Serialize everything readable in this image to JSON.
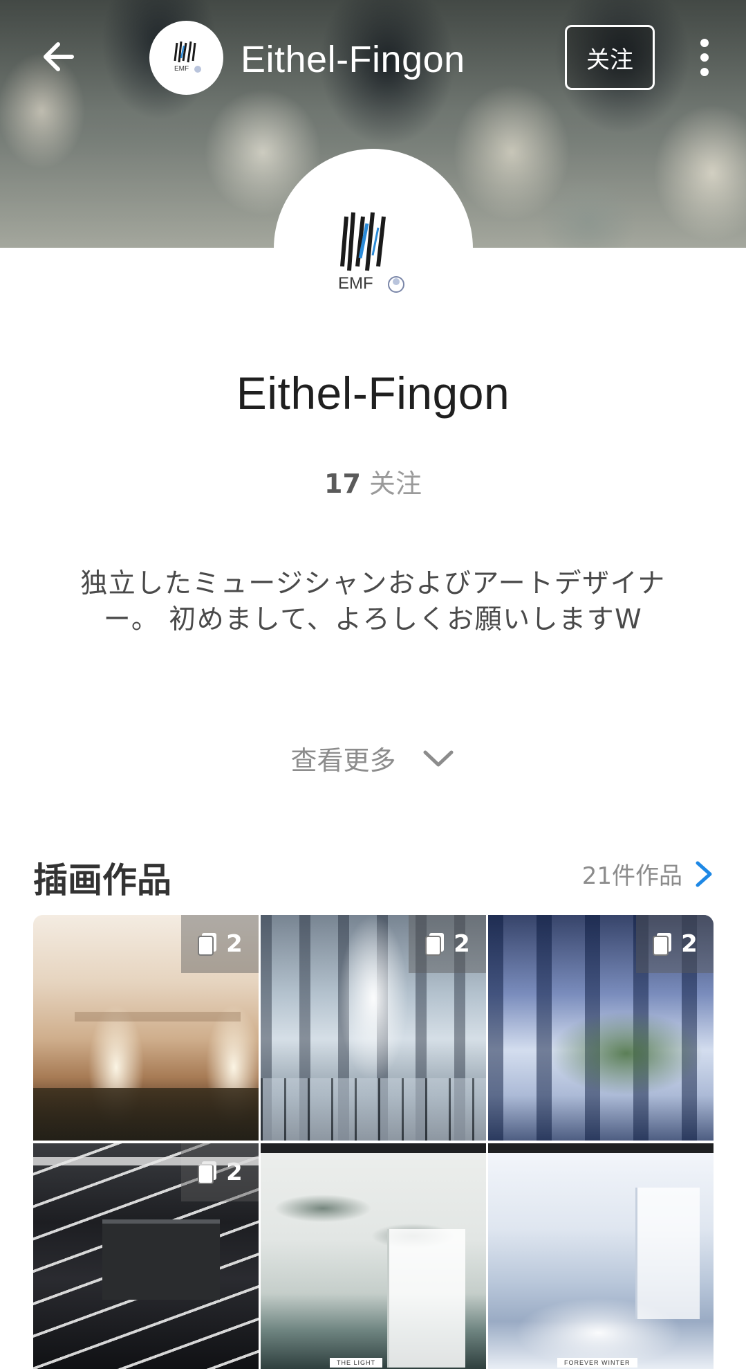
{
  "header": {
    "title": "Eithel-Fingon",
    "follow_label": "关注",
    "colors": {
      "text": "#ffffff"
    }
  },
  "avatar": {
    "logo_text": "EMF"
  },
  "profile": {
    "name": "Eithel-Fingon",
    "following_count": "17",
    "following_label": "关注",
    "bio": "独立したミュージシャンおよびアートデザイナー。 初めまして、よろしくお願いしますW",
    "see_more_label": "查看更多"
  },
  "section": {
    "title": "插画作品",
    "count_label": "21件作品",
    "link_color": "#1e88e5"
  },
  "artworks": [
    {
      "page_count": "2",
      "icon": "pages-icon"
    },
    {
      "page_count": "2",
      "icon": "pages-icon"
    },
    {
      "page_count": "2",
      "icon": "pages-icon"
    },
    {
      "page_count": "2",
      "icon": "pages-icon"
    },
    {
      "caption": "THE LIGHT"
    },
    {
      "caption": "FOREVER WINTER"
    }
  ],
  "icons": {
    "back": "arrow-left-icon",
    "more": "more-vertical-icon",
    "expand": "chevron-down-icon",
    "link": "chevron-right-icon"
  }
}
